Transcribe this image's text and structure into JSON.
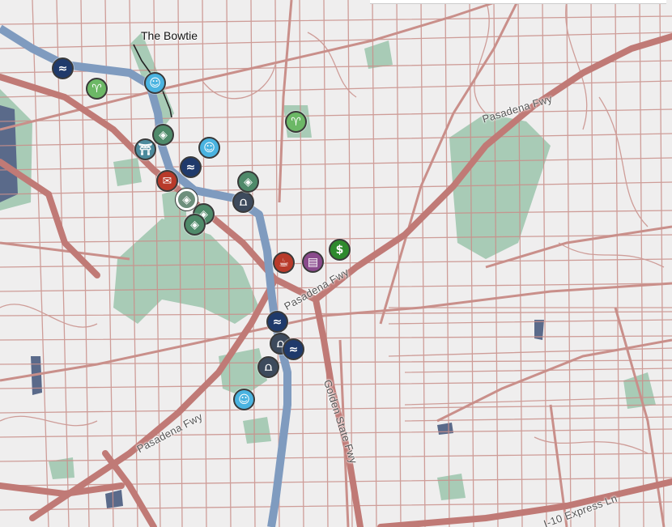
{
  "map": {
    "place_label": "The Bowtie",
    "road_labels": {
      "pasadena_fwy_ne": "Pasadena Fwy",
      "pasadena_fwy_mid": "Pasadena Fwy",
      "pasadena_fwy_sw": "Pasadena Fwy",
      "golden_state_fwy": "Golden State Fwy",
      "i10_express": "I-10 Express Ln"
    },
    "colors": {
      "background": "#efeeee",
      "street": "#c98f8a",
      "freeway": "#c07a76",
      "river": "#7f9bbf",
      "park": "#a8cbb6",
      "water": "#5a6a8a"
    },
    "markers": [
      {
        "icon": "river-icon",
        "color": "#1f3a6b",
        "glyph": "≈"
      },
      {
        "icon": "plant-icon",
        "color": "#6cb866",
        "glyph": "♈"
      },
      {
        "icon": "person-icon",
        "color": "#4ab3e0",
        "glyph": "☺"
      },
      {
        "icon": "trail-icon",
        "color": "#4f8a6a",
        "glyph": "◈"
      },
      {
        "icon": "gate-icon",
        "color": "#4c8a9c",
        "glyph": "⛩"
      },
      {
        "icon": "person-icon",
        "color": "#4ab3e0",
        "glyph": "☺"
      },
      {
        "icon": "river-icon",
        "color": "#1f3a6b",
        "glyph": "≈"
      },
      {
        "icon": "megaphone-icon",
        "color": "#b83a2a",
        "glyph": "✉"
      },
      {
        "icon": "trail-icon",
        "color": "#6d8f7c",
        "glyph": "◈"
      },
      {
        "icon": "trail-icon",
        "color": "#4f8a6a",
        "glyph": "◈"
      },
      {
        "icon": "trail-icon",
        "color": "#4f8a6a",
        "glyph": "◈"
      },
      {
        "icon": "bridge-icon",
        "color": "#3d4a5c",
        "glyph": "⩍"
      },
      {
        "icon": "trail-icon",
        "color": "#4f8a6a",
        "glyph": "◈"
      },
      {
        "icon": "plant-icon",
        "color": "#6cb866",
        "glyph": "♈"
      },
      {
        "icon": "cafe-icon",
        "color": "#b83a2a",
        "glyph": "☕"
      },
      {
        "icon": "book-icon",
        "color": "#8a4a8c",
        "glyph": "▤"
      },
      {
        "icon": "dollar-icon",
        "color": "#2e8a2e",
        "glyph": "$"
      },
      {
        "icon": "river-icon",
        "color": "#1f3a6b",
        "glyph": "≈"
      },
      {
        "icon": "bridge-icon",
        "color": "#3d4a5c",
        "glyph": "⩍"
      },
      {
        "icon": "river-icon",
        "color": "#1f3a6b",
        "glyph": "≈"
      },
      {
        "icon": "bridge-icon",
        "color": "#3d4a5c",
        "glyph": "⩍"
      },
      {
        "icon": "person-icon",
        "color": "#4ab3e0",
        "glyph": "☺"
      }
    ]
  }
}
